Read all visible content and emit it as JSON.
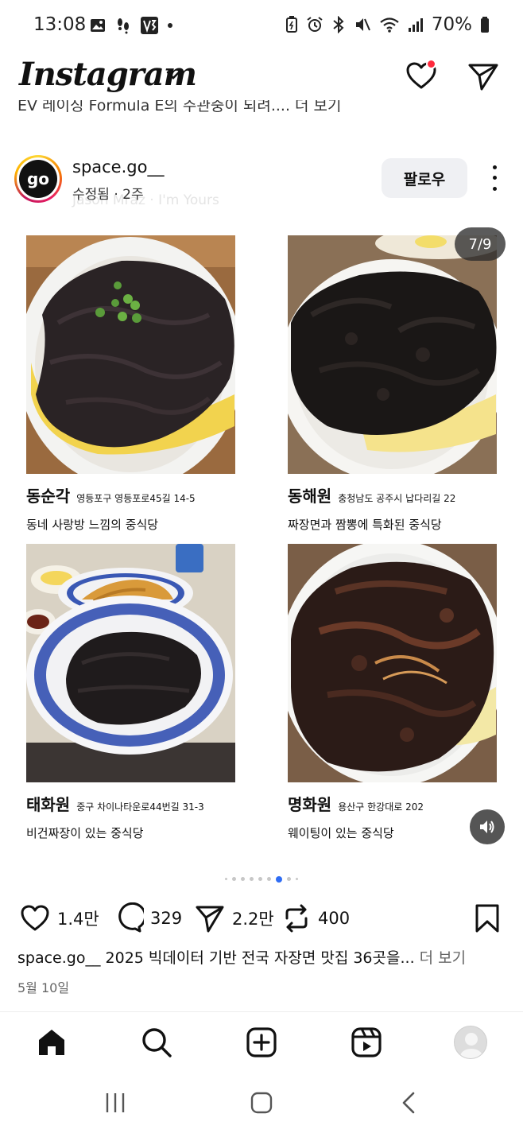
{
  "status_bar": {
    "time": "13:08",
    "battery": "70%"
  },
  "header": {
    "logo": "Instagram"
  },
  "previous_post_caption": "EV 레이싱 Formula E의 주관중이 되려.... 더 보기",
  "post": {
    "avatar_text": "go",
    "username": "space.go__",
    "meta": "수정됨 · 2주",
    "music": "Jason Mraz · I'm Yours",
    "follow_label": "팔로우",
    "counter": "7/9",
    "restaurants": [
      {
        "name": "동순각",
        "address": "영등포구 영등포로45길 14-5",
        "description": "동네 사랑방 느낌의 중식당"
      },
      {
        "name": "동해원",
        "address": "충청남도 공주시 납다리길 22",
        "description": "짜장면과 짬뽕에 특화된 중식당"
      },
      {
        "name": "태화원",
        "address": "중구 차이나타운로44번길 31-3",
        "description": "비건짜장이 있는 중식당"
      },
      {
        "name": "명화원",
        "address": "용산구 한강대로 202",
        "description": "웨이팅이 있는 중식당"
      }
    ],
    "likes": "1.4만",
    "comments": "329",
    "shares": "2.2만",
    "reposts": "400",
    "caption_username": "space.go__",
    "caption_text": "2025 빅데이터 기반 전국 자장면 맛집 36곳을...",
    "caption_more": "더 보기",
    "date": "5월 10일"
  },
  "icons": {
    "notifications": "heart-icon",
    "direct": "paper-plane-icon",
    "home": "home-icon",
    "search": "search-icon",
    "create": "plus-square-icon",
    "reels": "reels-icon",
    "sound": "speaker-icon"
  },
  "colors": {
    "notification_dot": "#ff2a3d",
    "active_dot": "#2f6df4",
    "follow_bg": "#eff0f3"
  }
}
